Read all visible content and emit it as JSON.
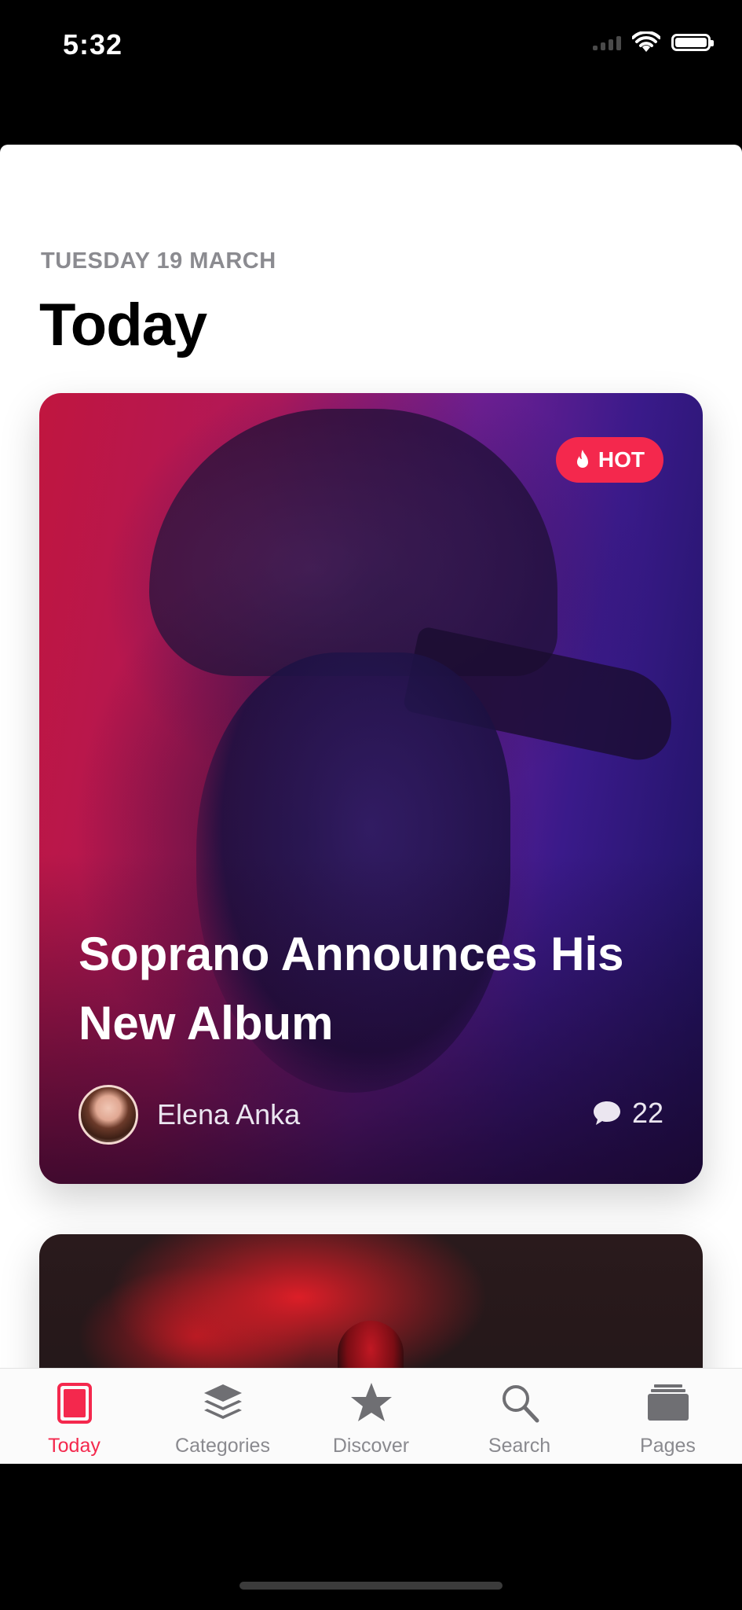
{
  "status_bar": {
    "time": "5:32"
  },
  "header": {
    "date": "TUESDAY 19 MARCH",
    "title": "Today"
  },
  "featured_card": {
    "badge": "HOT",
    "badge_icon": "flame-icon",
    "title": "Soprano Announces His New Album",
    "author": "Elena Anka",
    "comment_count": "22",
    "comment_icon": "speech-bubble-icon"
  },
  "tab_bar": {
    "active_color": "#f4284d",
    "inactive_color": "#8a8a8f",
    "tabs": [
      {
        "label": "Today",
        "icon": "today-icon",
        "active": true
      },
      {
        "label": "Categories",
        "icon": "layers-icon",
        "active": false
      },
      {
        "label": "Discover",
        "icon": "star-icon",
        "active": false
      },
      {
        "label": "Search",
        "icon": "search-icon",
        "active": false
      },
      {
        "label": "Pages",
        "icon": "pages-icon",
        "active": false
      }
    ]
  }
}
